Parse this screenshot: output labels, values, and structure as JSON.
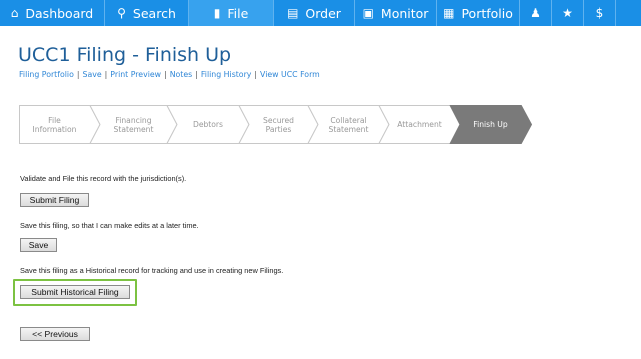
{
  "nav": {
    "items": [
      {
        "label": "Dashboard",
        "icon": "home-icon",
        "glyph": "⌂",
        "active": false
      },
      {
        "label": "Search",
        "icon": "search-icon",
        "glyph": "⚲",
        "active": false
      },
      {
        "label": "File",
        "icon": "file-icon",
        "glyph": "▮",
        "active": true
      },
      {
        "label": "Order",
        "icon": "cart-icon",
        "glyph": "▤",
        "active": false
      },
      {
        "label": "Monitor",
        "icon": "monitor-icon",
        "glyph": "▣",
        "active": false
      },
      {
        "label": "Portfolio",
        "icon": "portfolio-icon",
        "glyph": "▦",
        "active": false
      },
      {
        "label": "",
        "icon": "user-icon",
        "glyph": "♟",
        "active": false
      },
      {
        "label": "",
        "icon": "star-icon",
        "glyph": "★",
        "active": false
      },
      {
        "label": "",
        "icon": "dollar-icon",
        "glyph": "$",
        "active": false
      }
    ],
    "color": "#1a8fe6"
  },
  "page": {
    "title": "UCC1 Filing - Finish Up",
    "links": [
      "Filing Portfolio",
      "Save",
      "Print Preview",
      "Notes",
      "Filing History",
      "View UCC Form"
    ],
    "link_separator": "|"
  },
  "steps": [
    {
      "label": "File\nInformation",
      "active": false
    },
    {
      "label": "Financing\nStatement",
      "active": false
    },
    {
      "label": "Debtors",
      "active": false
    },
    {
      "label": "Secured\nParties",
      "active": false
    },
    {
      "label": "Collateral\nStatement",
      "active": false
    },
    {
      "label": "Attachment",
      "active": false
    },
    {
      "label": "Finish Up",
      "active": true
    }
  ],
  "actions": {
    "validate_text": "Validate and File this record with the jurisdiction(s).",
    "submit_label": "Submit Filing",
    "save_text": "Save this filing, so that I can make edits at a later time.",
    "save_label": "Save",
    "historical_text": "Save this filing as a Historical record for tracking and use in creating new Filings.",
    "historical_label": "Submit Historical Filing",
    "previous_label": "<< Previous"
  },
  "colors": {
    "accent": "#1a8fe6",
    "title": "#1f5f99",
    "link": "#2f86d6",
    "step_active": "#7a7a7a",
    "highlight": "#7cc242"
  }
}
